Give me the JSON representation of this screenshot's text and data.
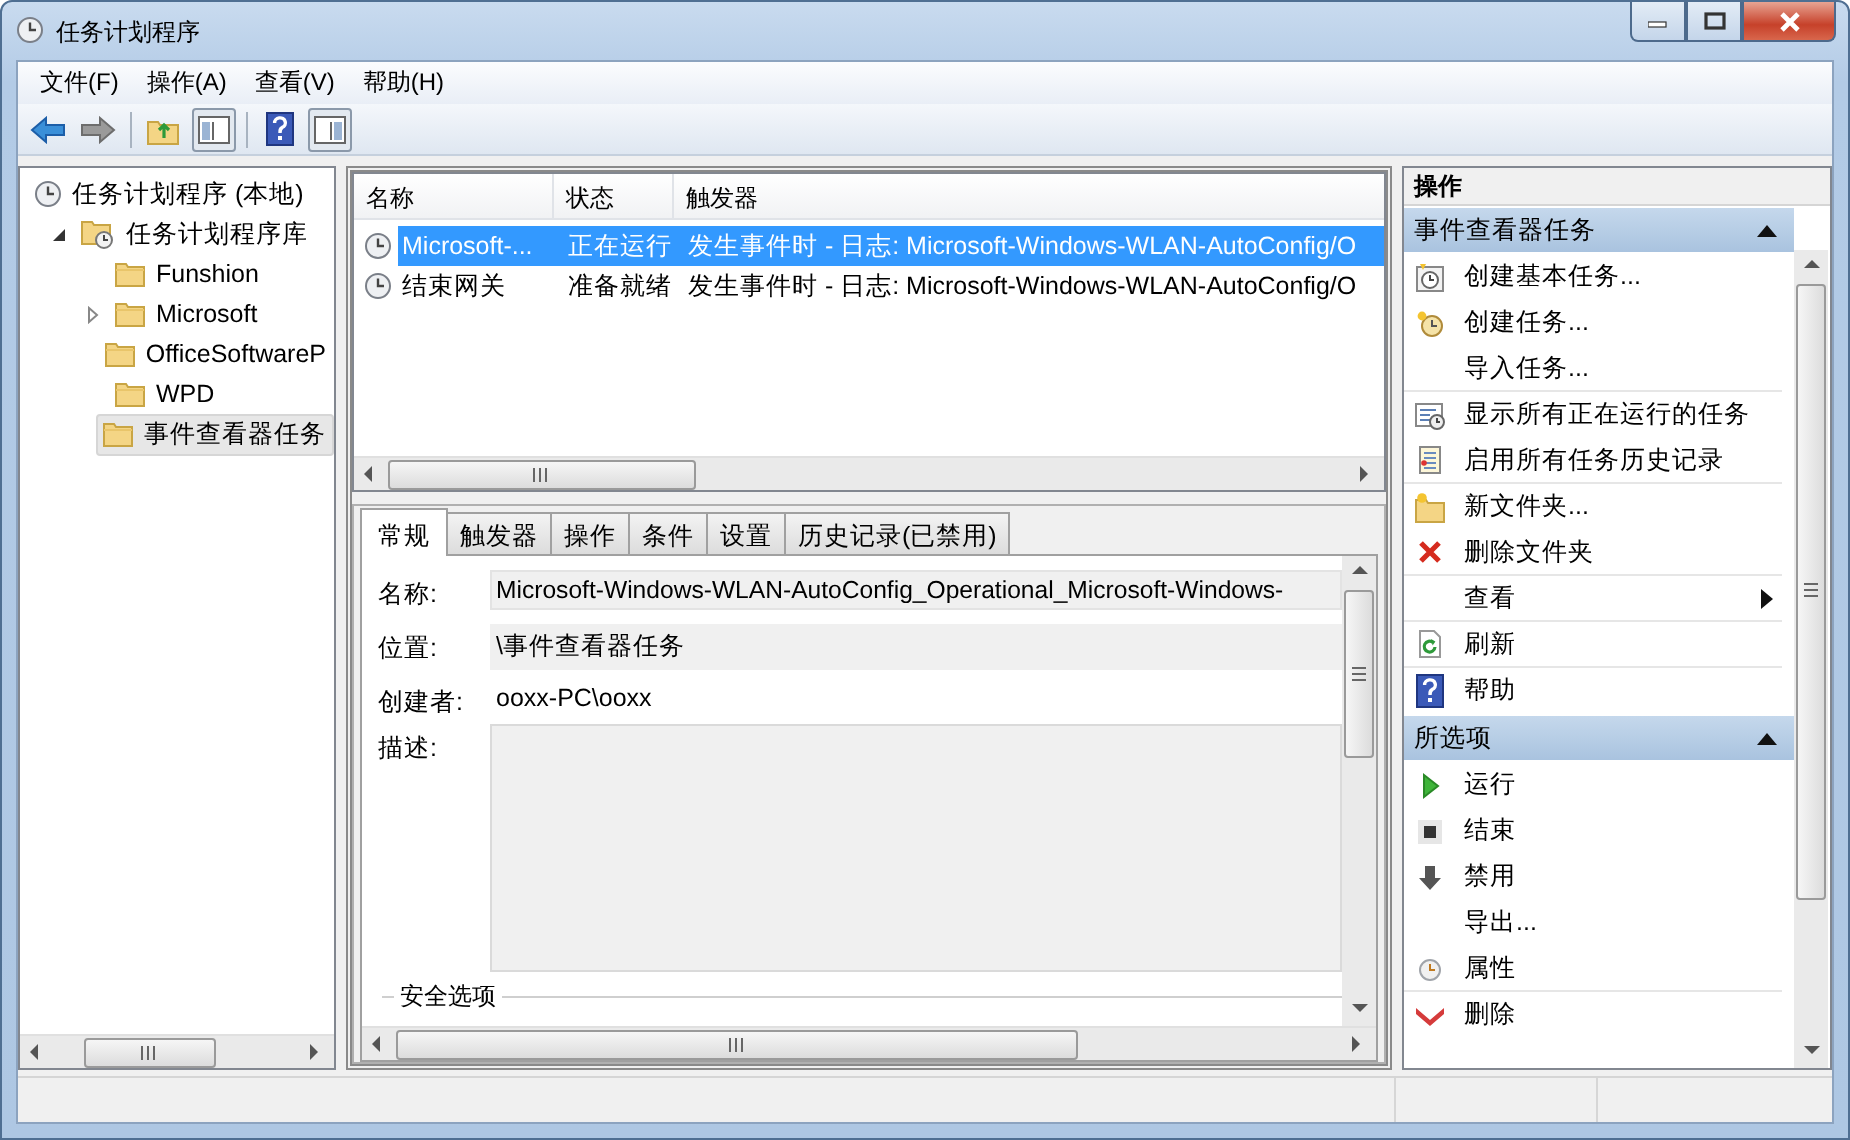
{
  "window": {
    "title": "任务计划程序"
  },
  "menu": [
    "文件(F)",
    "操作(A)",
    "查看(V)",
    "帮助(H)"
  ],
  "tree": [
    {
      "label": "任务计划程序 (本地)",
      "selected": false,
      "children": [
        {
          "label": "任务计划程序库",
          "expanded": true,
          "selected": false,
          "children": [
            {
              "label": "Funshion",
              "selected": false
            },
            {
              "label": "Microsoft",
              "expanded": false,
              "selected": false
            },
            {
              "label": "OfficeSoftwareP",
              "selected": false
            },
            {
              "label": "WPD",
              "selected": false
            },
            {
              "label": "事件查看器任务",
              "selected": true
            }
          ]
        }
      ]
    }
  ],
  "task_list": {
    "columns": [
      "名称",
      "状态",
      "触发器"
    ],
    "rows": [
      {
        "cells": [
          "Microsoft-...",
          "正在运行",
          "发生事件时 - 日志: Microsoft-Windows-WLAN-AutoConfig/O"
        ],
        "selected": true
      },
      {
        "cells": [
          "结束网关",
          "准备就绪",
          "发生事件时 - 日志: Microsoft-Windows-WLAN-AutoConfig/O"
        ],
        "selected": false
      }
    ]
  },
  "task_detail": {
    "tabs": [
      {
        "label": "常规",
        "selected": true
      },
      {
        "label": "触发器",
        "selected": false
      },
      {
        "label": "操作",
        "selected": false
      },
      {
        "label": "条件",
        "selected": false
      },
      {
        "label": "设置",
        "selected": false
      },
      {
        "label": "历史记录(已禁用)",
        "selected": false
      }
    ],
    "fields": [
      {
        "kind": "field",
        "label": "名称:",
        "value": "Microsoft-Windows-WLAN-AutoConfig_Operational_Microsoft-Windows-"
      },
      {
        "kind": "readonly",
        "label": "位置:",
        "value": "\\事件查看器任务"
      },
      {
        "kind": "plain",
        "label": "创建者:",
        "value": "ooxx-PC\\ooxx"
      },
      {
        "kind": "textarea",
        "label": "描述:"
      }
    ],
    "group_title": "安全选项"
  },
  "actions": {
    "title": "操作",
    "sections": [
      {
        "title": "事件查看器任务",
        "expanded": true,
        "groups": [
          [
            {
              "label": "创建基本任务..."
            },
            {
              "label": "创建任务..."
            },
            {
              "label": "导入任务..."
            }
          ],
          [
            {
              "label": "显示所有正在运行的任务"
            },
            {
              "label": "启用所有任务历史记录"
            }
          ],
          [
            {
              "label": "新文件夹..."
            },
            {
              "label": "删除文件夹"
            }
          ],
          [
            {
              "label": "查看",
              "submenu": true
            }
          ],
          [
            {
              "label": "刷新"
            }
          ],
          [
            {
              "label": "帮助"
            }
          ]
        ]
      },
      {
        "title": "所选项",
        "expanded": true,
        "groups": [
          [
            {
              "label": "运行"
            },
            {
              "label": "结束"
            },
            {
              "label": "禁用"
            },
            {
              "label": "导出..."
            },
            {
              "label": "属性"
            }
          ],
          [
            {
              "label": "删除"
            }
          ]
        ]
      }
    ]
  }
}
